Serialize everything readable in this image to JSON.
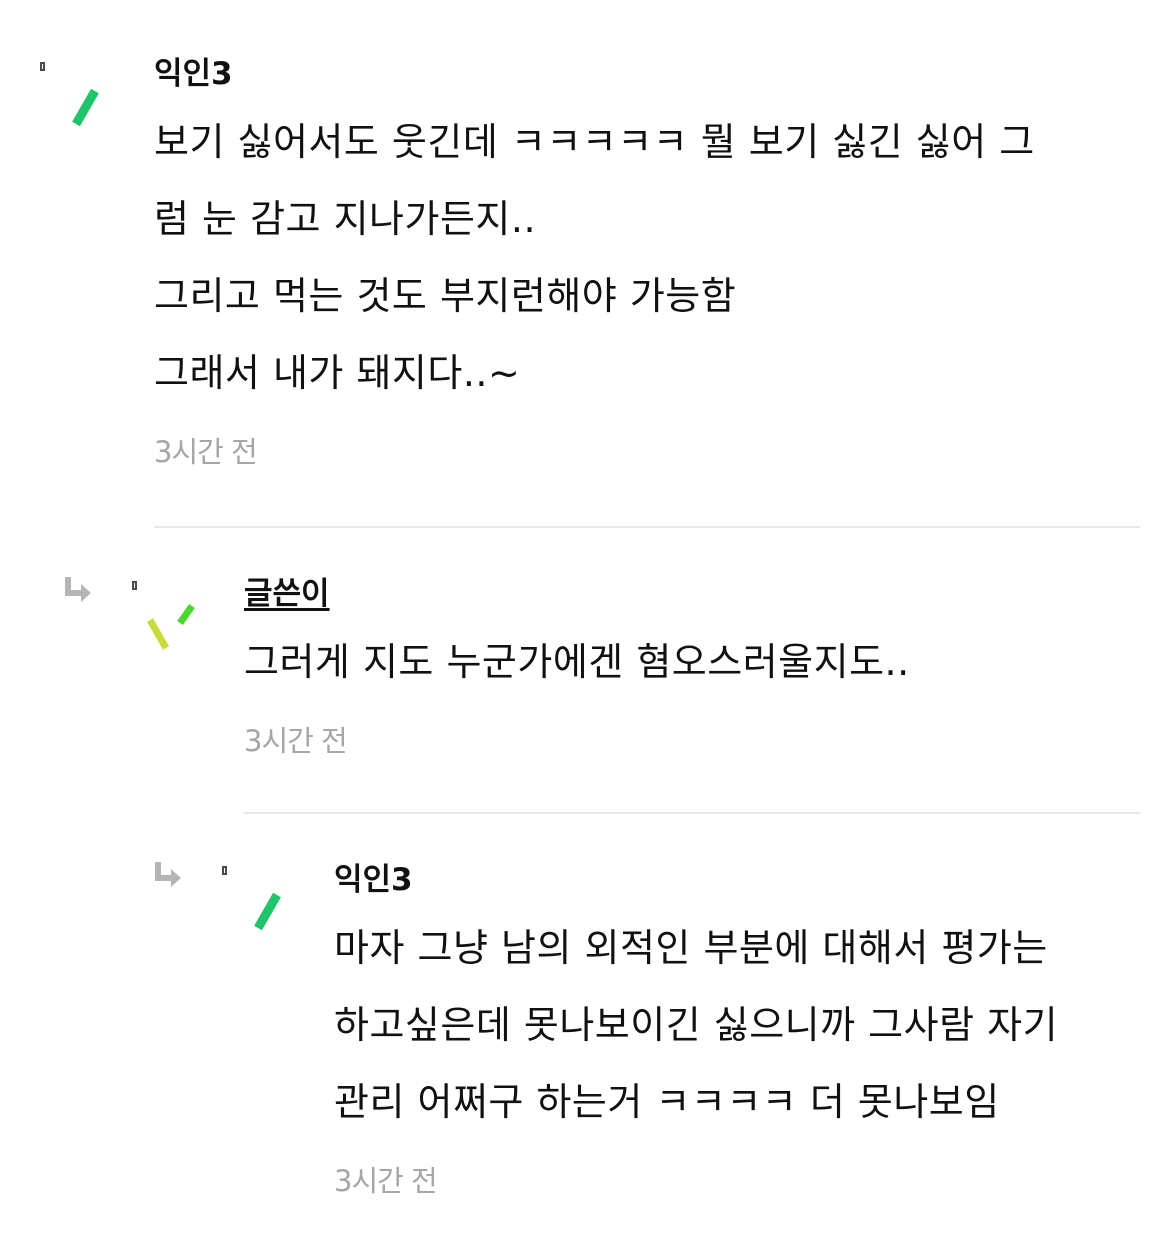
{
  "comments": [
    {
      "author": "익인3",
      "lines": [
        "보기 싫어서도 웃긴데 ㅋㅋㅋㅋㅋ 뭘 보기 싫긴 싫어 그",
        "럼 눈 감고 지나가든지..",
        "그리고 먹는 것도 부지런해야 가능함",
        "그래서 내가 돼지다..~"
      ],
      "time": "3시간 전"
    },
    {
      "author": "글쓴이",
      "lines": [
        "그러게 지도 누군가에겐 혐오스러울지도.."
      ],
      "time": "3시간 전"
    },
    {
      "author": "익인3",
      "lines": [
        "마자 그냥 남의 외적인 부분에 대해서 평가는",
        "하고싶은데 못나보이긴 싫으니까 그사람 자기",
        "관리 어쩌구 하는거 ㅋㅋㅋㅋ 더 못나보임"
      ],
      "time": "3시간 전"
    }
  ],
  "icons": {
    "reply_arrow": "reply-arrow-icon",
    "avatar_mark": "avatar-stroke-icon"
  },
  "colors": {
    "green": "#1fc46b",
    "lime": "#c9dc3a",
    "bright_green": "#4cd62e",
    "time_gray": "#a6a6a6",
    "arrow_gray": "#b5b5b5",
    "divider": "#e8e8e8"
  }
}
